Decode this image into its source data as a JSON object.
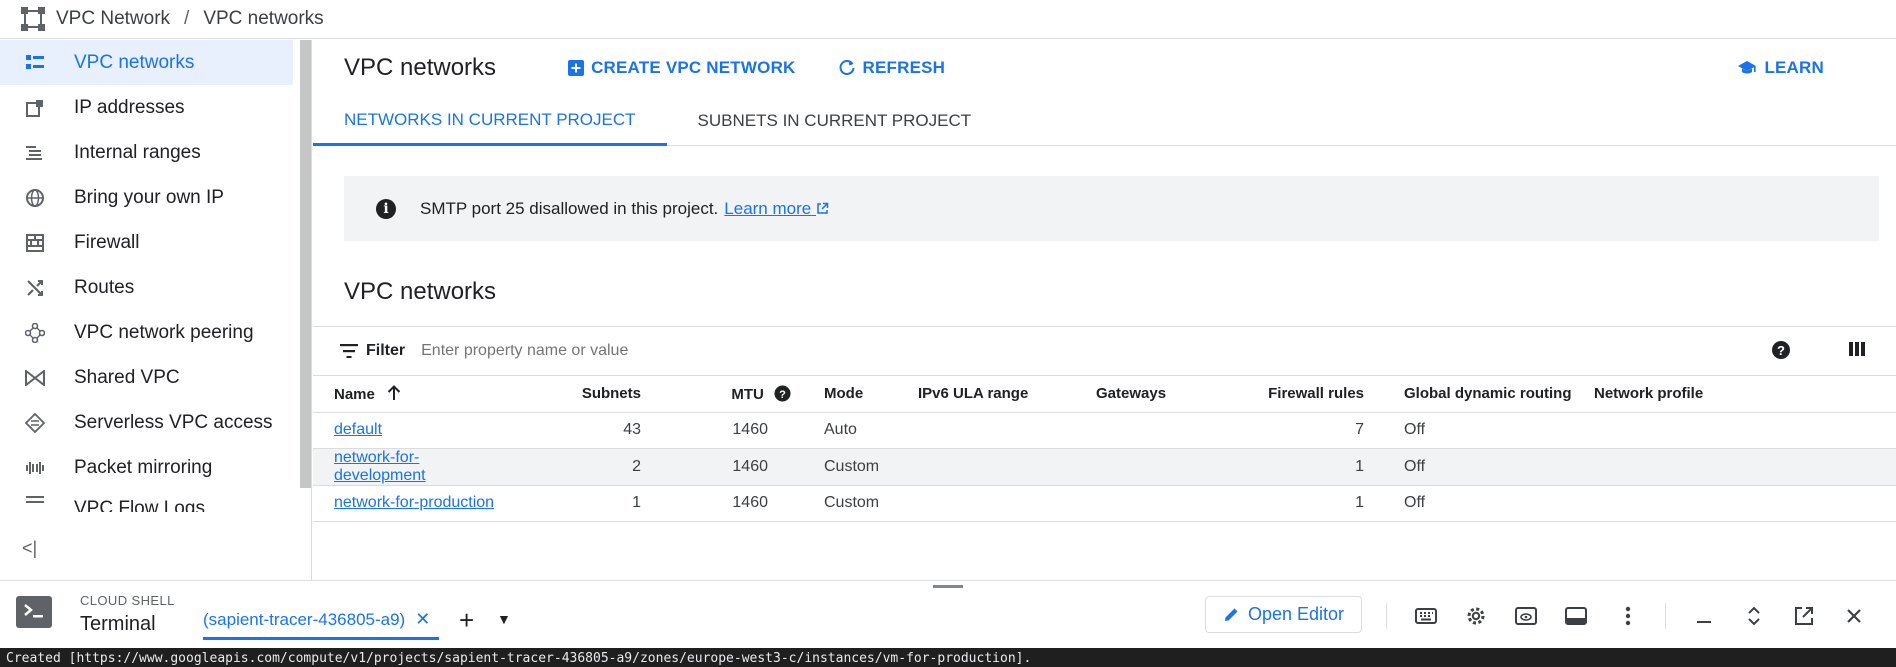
{
  "breadcrumb": {
    "product": "VPC Network",
    "separator": "/",
    "page": "VPC networks"
  },
  "sidebar": {
    "items": [
      {
        "label": "VPC networks",
        "icon": "vpc-networks-icon",
        "active": true
      },
      {
        "label": "IP addresses",
        "icon": "ip-addresses-icon"
      },
      {
        "label": "Internal ranges",
        "icon": "internal-ranges-icon"
      },
      {
        "label": "Bring your own IP",
        "icon": "globe-icon"
      },
      {
        "label": "Firewall",
        "icon": "firewall-icon"
      },
      {
        "label": "Routes",
        "icon": "routes-icon"
      },
      {
        "label": "VPC network peering",
        "icon": "peering-icon"
      },
      {
        "label": "Shared VPC",
        "icon": "shared-vpc-icon"
      },
      {
        "label": "Serverless VPC access",
        "icon": "serverless-icon"
      },
      {
        "label": "Packet mirroring",
        "icon": "packet-mirroring-icon"
      },
      {
        "label": "VPC Flow Logs",
        "icon": "flow-logs-icon"
      }
    ],
    "collapse_glyph": "<|"
  },
  "header": {
    "title": "VPC networks",
    "create_label": "CREATE VPC NETWORK",
    "refresh_label": "REFRESH",
    "learn_label": "LEARN"
  },
  "tabs": [
    {
      "label": "NETWORKS IN CURRENT PROJECT",
      "active": true
    },
    {
      "label": "SUBNETS IN CURRENT PROJECT",
      "active": false
    }
  ],
  "banner": {
    "text": "SMTP port 25 disallowed in this project.",
    "link": "Learn more"
  },
  "section_title": "VPC networks",
  "filter": {
    "label": "Filter",
    "placeholder": "Enter property name or value"
  },
  "table": {
    "columns": [
      "Name",
      "Subnets",
      "MTU",
      "Mode",
      "IPv6 ULA range",
      "Gateways",
      "Firewall rules",
      "Global dynamic routing",
      "Network profile"
    ],
    "rows": [
      {
        "name": "default",
        "subnets": "43",
        "mtu": "1460",
        "mode": "Auto",
        "ipv6": "",
        "gateways": "",
        "firewall": "7",
        "routing": "Off",
        "profile": ""
      },
      {
        "name": "network-for-development",
        "subnets": "2",
        "mtu": "1460",
        "mode": "Custom",
        "ipv6": "",
        "gateways": "",
        "firewall": "1",
        "routing": "Off",
        "profile": ""
      },
      {
        "name": "network-for-production",
        "subnets": "1",
        "mtu": "1460",
        "mode": "Custom",
        "ipv6": "",
        "gateways": "",
        "firewall": "1",
        "routing": "Off",
        "profile": ""
      }
    ]
  },
  "shell": {
    "label": "CLOUD SHELL",
    "terminal_label": "Terminal",
    "tab_label": "(sapient-tracer-436805-a9)",
    "editor_label": "Open Editor",
    "output_line": "Created [https://www.googleapis.com/compute/v1/projects/sapient-tracer-436805-a9/zones/europe-west3-c/instances/vm-for-production]."
  },
  "colors": {
    "accent": "#1a73e8",
    "active_bg": "#e8f0fe",
    "banner_bg": "#f1f3f4"
  }
}
